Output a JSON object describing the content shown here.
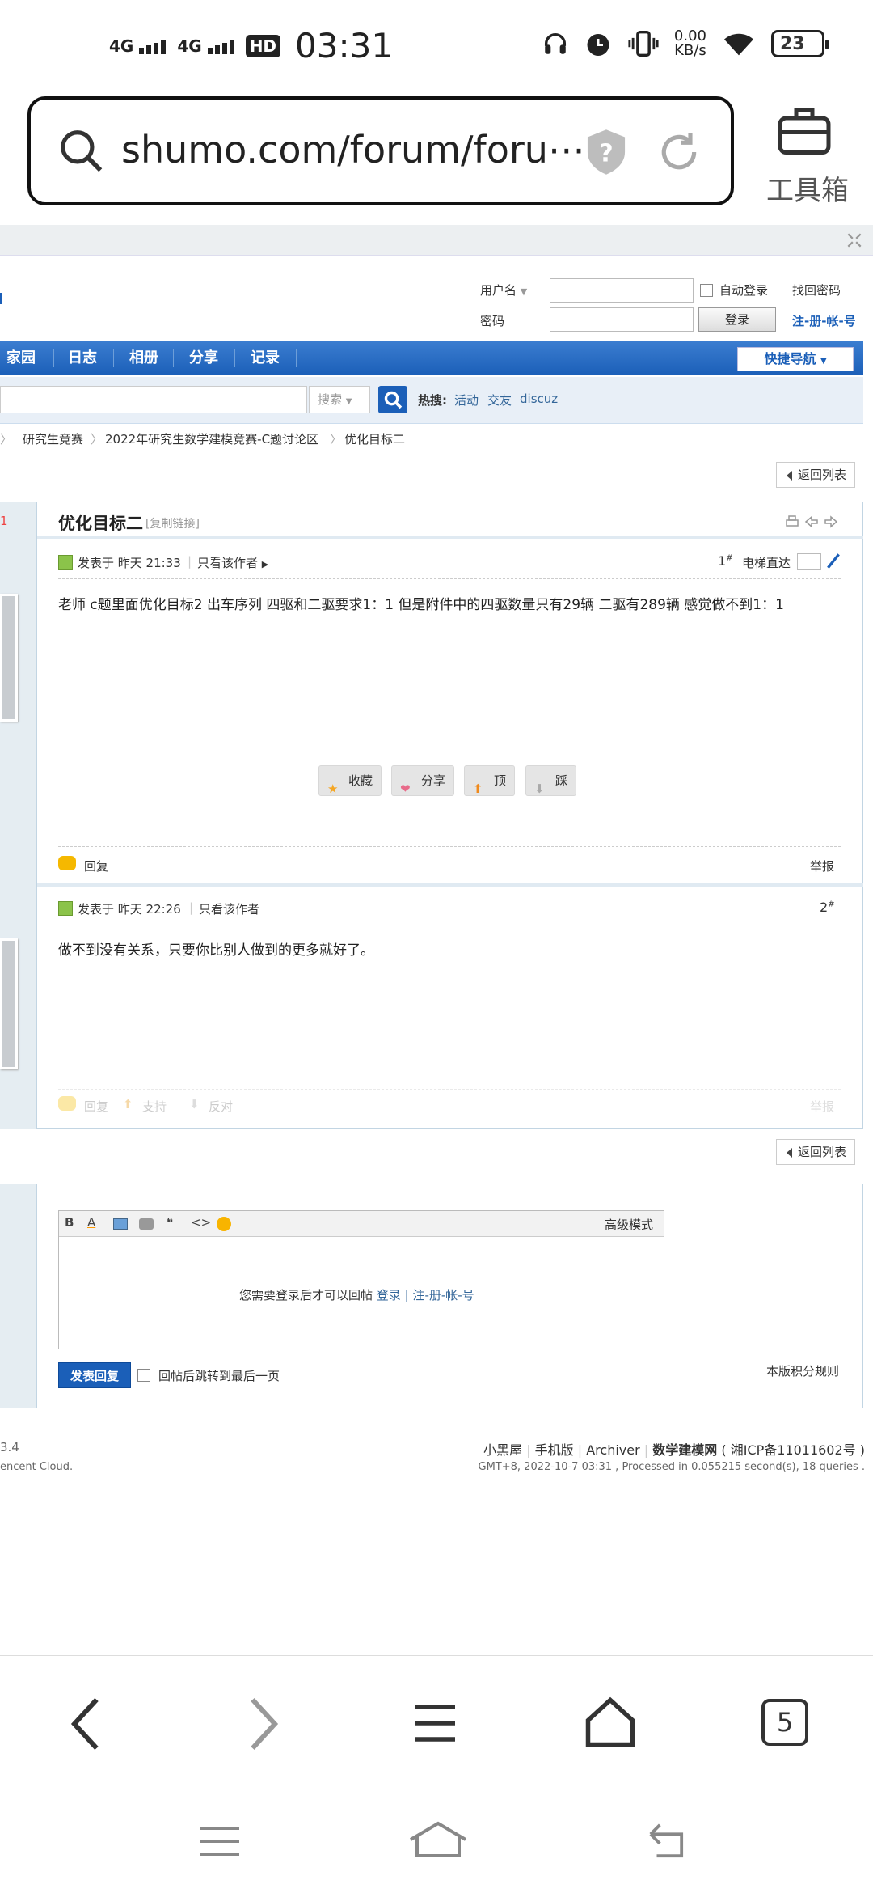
{
  "status_bar": {
    "signal1": "4G",
    "signal2": "4G",
    "hd": "HD",
    "time": "03:31",
    "net_speed_value": "0.00",
    "net_speed_unit": "KB/s",
    "battery": "23"
  },
  "browser": {
    "url": "shumo.com/forum/foru⋯",
    "toolbox": "工具箱",
    "tab_count": "5"
  },
  "login": {
    "username_label": "用户名",
    "password_label": "密码",
    "auto_login": "自动登录",
    "find_password": "找回密码",
    "login_button": "登录",
    "register": "注-册-帐-号"
  },
  "nav": {
    "items": [
      "家园",
      "日志",
      "相册",
      "分享",
      "记录"
    ],
    "quick_nav": "快捷导航"
  },
  "search": {
    "type": "搜索",
    "hot_label": "热搜:",
    "hot_items": [
      "活动",
      "交友",
      "discuz"
    ]
  },
  "breadcrumb": [
    "研究生竞赛",
    "2022年研究生数学建模竞赛-C题讨论区",
    "优化目标二"
  ],
  "back_to_list": "返回列表",
  "thread": {
    "title": "优化目标二",
    "copy_link": "[复制链接]",
    "side_number": "1"
  },
  "posts": [
    {
      "meta": "发表于 昨天 21:33",
      "only_author": "只看该作者",
      "floor": "1",
      "floor_mark": "#",
      "elevator": "电梯直达",
      "content": "老师 c题里面优化目标2   出车序列 四驱和二驱要求1：1  但是附件中的四驱数量只有29辆   二驱有289辆   感觉做不到1：1",
      "actions": [
        "收藏",
        "分享",
        "顶",
        "踩"
      ],
      "reply": "回复",
      "report": "举报"
    },
    {
      "meta": "发表于 昨天 22:26",
      "only_author": "只看该作者",
      "floor": "2",
      "floor_mark": "#",
      "content": "做不到没有关系，只要你比别人做到的更多就好了。",
      "reply": "回复",
      "support": "支持",
      "oppose": "反对",
      "report": "举报"
    }
  ],
  "editor": {
    "advanced_mode": "高级模式",
    "login_prompt": "您需要登录后才可以回帖",
    "login_link": "登录",
    "separator": "|",
    "register_link": "注-册-帐-号",
    "submit": "发表回复",
    "jump_last": "回帖后跳转到最后一页",
    "rules": "本版积分规则"
  },
  "footer": {
    "left1": "3.4",
    "left2": "encent Cloud.",
    "links": [
      "小黑屋",
      "手机版",
      "Archiver"
    ],
    "site_name": "数学建模网",
    "icp": "( 湘ICP备11011602号 )",
    "meta": "GMT+8, 2022-10-7 03:31 , Processed in 0.055215 second(s), 18 queries ."
  }
}
